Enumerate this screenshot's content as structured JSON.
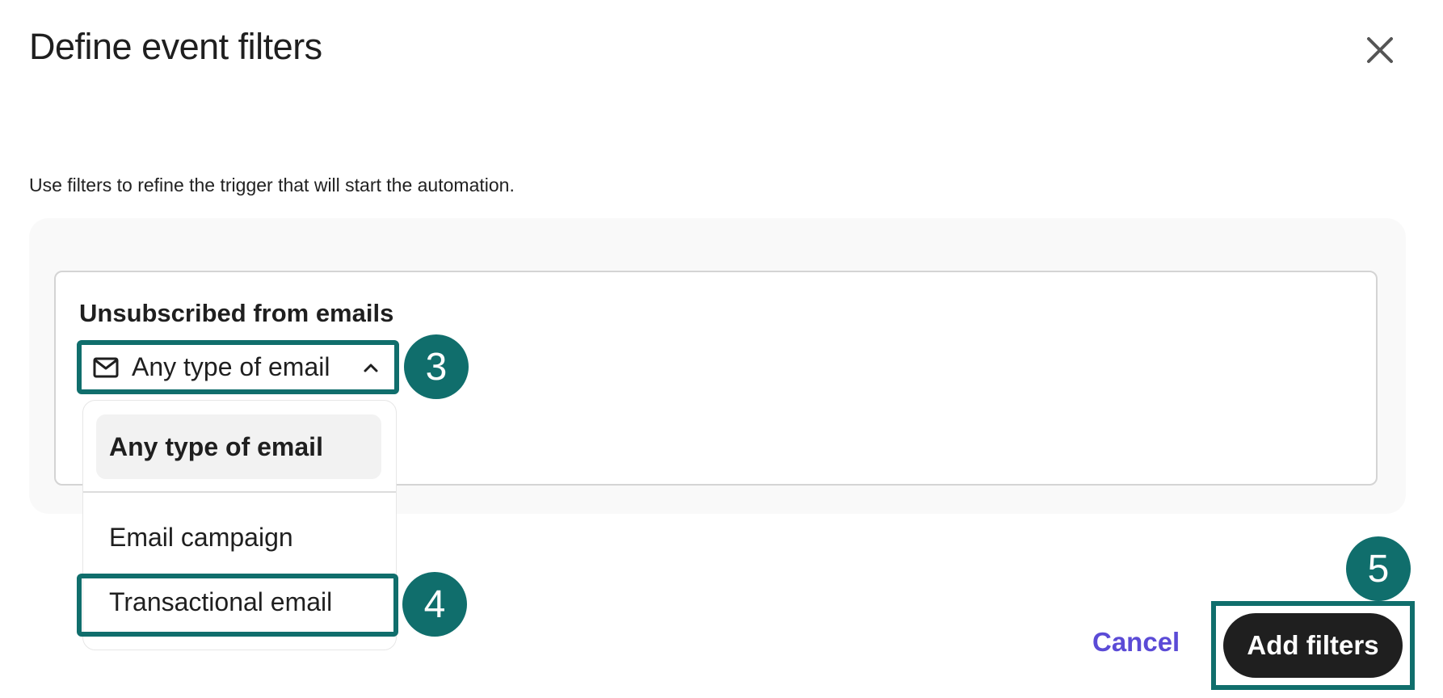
{
  "dialog": {
    "title": "Define event filters",
    "description": "Use filters to refine the trigger that will start the automation."
  },
  "filter_card": {
    "title": "Unsubscribed from emails",
    "select": {
      "value": "Any type of email",
      "icon": "mail-icon",
      "state": "expanded"
    },
    "options": [
      {
        "label": "Any type of email",
        "selected": true
      },
      {
        "label": "Email campaign",
        "selected": false
      },
      {
        "label": "Transactional email",
        "selected": false
      }
    ]
  },
  "footer": {
    "cancel_label": "Cancel",
    "add_label": "Add filters"
  },
  "steps": [
    "3",
    "4",
    "5"
  ],
  "colors": {
    "annotation": "#106e6c",
    "link": "#5b4bd6",
    "primary_button": "#1f1f1f",
    "panel_bg": "#f9f9f9"
  }
}
